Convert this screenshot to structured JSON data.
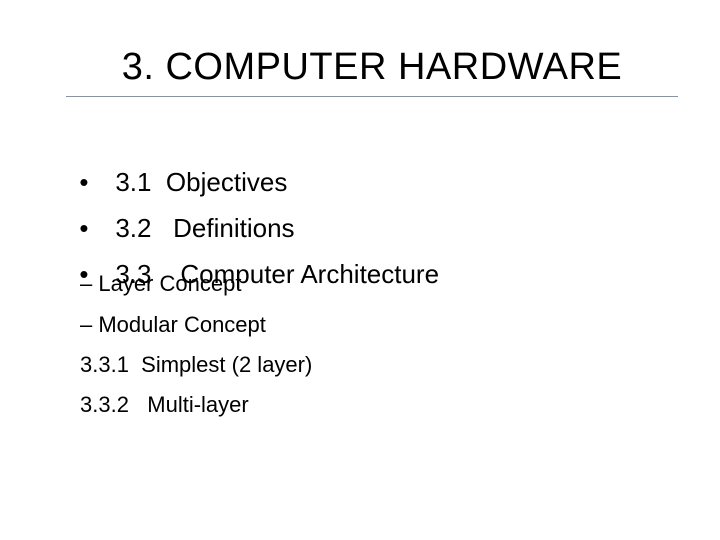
{
  "slide": {
    "title": "3.  COMPUTER HARDWARE",
    "bullet_glyph": "•",
    "bullets": [
      {
        "text": "3.1  Objectives"
      },
      {
        "text": "3.2   Definitions"
      },
      {
        "text": "3.3    Computer Architecture"
      }
    ],
    "sub_items": [
      {
        "text": "– Layer Concept"
      },
      {
        "text": "– Modular Concept"
      },
      {
        "text": "3.3.1  Simplest (2 layer)"
      },
      {
        "text": "3.3.2   Multi-layer"
      }
    ],
    "colors": {
      "rule": "#8096ac",
      "text": "#000000",
      "background": "#ffffff"
    }
  }
}
